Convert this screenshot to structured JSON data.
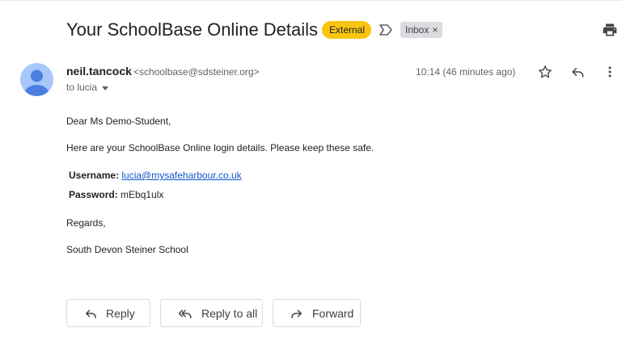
{
  "email": {
    "subject": "Your SchoolBase Online Details",
    "labels": {
      "external": "External",
      "inbox": "Inbox",
      "inbox_remove": "×"
    },
    "sender": {
      "name": "neil.tancock",
      "email": "<schoolbase@sdsteiner.org>"
    },
    "recipient_line": "to lucia",
    "timestamp": "10:14 (46 minutes ago)",
    "body": {
      "greeting": "Dear Ms Demo-Student,",
      "intro": "Here are your SchoolBase Online login details. Please keep these safe.",
      "username_label": "Username:",
      "username_value": "lucia@mysafeharbour.co.uk",
      "password_label": "Password:",
      "password_value": "mEbq1ulx",
      "signoff": "Regards,",
      "signature": "South Devon Steiner School"
    }
  },
  "actions": {
    "reply": "Reply",
    "reply_all": "Reply to all",
    "forward": "Forward"
  },
  "icons": {
    "print": "print-icon",
    "important": "important-marker-icon",
    "avatar": "person-avatar-icon",
    "star": "star-icon",
    "reply": "reply-icon",
    "more": "more-vert-icon",
    "reply_all": "reply-all-icon",
    "forward": "forward-icon"
  },
  "colors": {
    "external_badge": "#f9c510",
    "link": "#1155cc",
    "avatar_bg": "#a8c7fa",
    "avatar_fg": "#4a7fe0"
  }
}
